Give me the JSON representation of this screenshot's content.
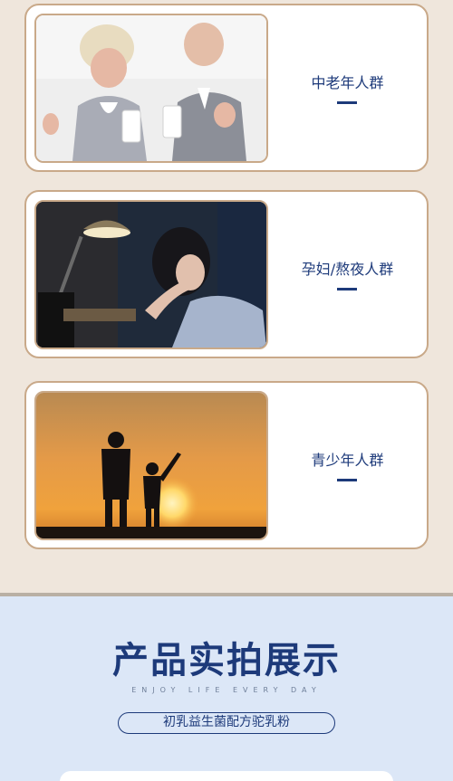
{
  "groups": [
    {
      "label": "中老年人群"
    },
    {
      "label": "孕妇/熬夜人群"
    },
    {
      "label": "青少年人群"
    }
  ],
  "showcase": {
    "title": "产品实拍展示",
    "subtitle": "ENJOY LIFE EVERY DAY",
    "product_name": "初乳益生菌配方驼乳粉"
  },
  "colors": {
    "navy": "#1d3a7a",
    "beige_bg": "#efe6dc",
    "card_border": "#c9a989",
    "blue_bg": "#dce7f7"
  }
}
